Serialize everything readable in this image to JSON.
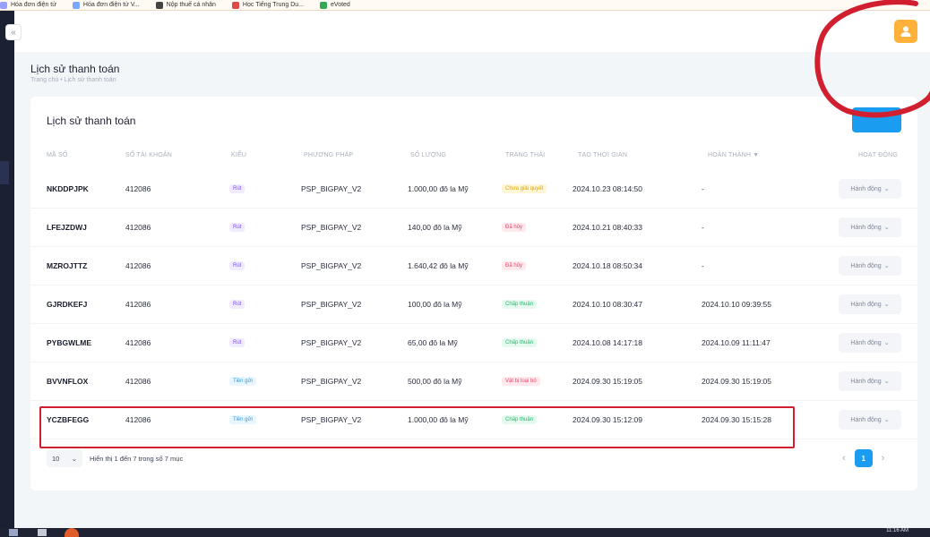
{
  "bookmarks": [
    {
      "label": "Hóa đơn điện tử",
      "color": "#9aa0ff"
    },
    {
      "label": "Hóa đơn điện tử V...",
      "color": "#7aa7ff"
    },
    {
      "label": "Nộp thuế cá nhân",
      "color": "#444444"
    },
    {
      "label": "Học Tiếng Trung Du...",
      "color": "#e04a4a"
    },
    {
      "label": "eVoted",
      "color": "#34a853"
    }
  ],
  "header": {
    "page_title": "Lịch sử thanh toán",
    "breadcrumb": "Trang chủ  •  Lịch sử thanh toán",
    "avatar_icon": "user-icon"
  },
  "card": {
    "title": "Lịch sử thanh toán",
    "columns": [
      "MÃ SỐ",
      "SỐ TÀI KHOẢN",
      "KIỂU",
      "PHƯƠNG PHÁP",
      "SỐ LƯỢNG",
      "TRẠNG THÁI",
      "TẠO THỜI GIAN",
      "HOÀN THÀNH ▼",
      "HOẠT ĐỘNG"
    ],
    "rows": [
      {
        "code": "NKDDPJPK",
        "account": "412086",
        "type": "Rút",
        "type_kind": "rut",
        "method": "PSP_BIGPAY_V2",
        "amount": "1.000,00 đô la Mỹ",
        "status": "Chưa giải quyết",
        "status_kind": "wait",
        "created": "2024.10.23 08:14:50",
        "completed": "-",
        "action": "Hành động"
      },
      {
        "code": "LFEJZDWJ",
        "account": "412086",
        "type": "Rút",
        "type_kind": "rut",
        "method": "PSP_BIGPAY_V2",
        "amount": "140,00 đô la Mỹ",
        "status": "Đã hủy",
        "status_kind": "cancel",
        "created": "2024.10.21 08:40:33",
        "completed": "-",
        "action": "Hành động"
      },
      {
        "code": "MZROJTTZ",
        "account": "412086",
        "type": "Rút",
        "type_kind": "rut",
        "method": "PSP_BIGPAY_V2",
        "amount": "1.640,42 đô la Mỹ",
        "status": "Đã hủy",
        "status_kind": "cancel",
        "created": "2024.10.18 08:50:34",
        "completed": "-",
        "action": "Hành động"
      },
      {
        "code": "GJRDKEFJ",
        "account": "412086",
        "type": "Rút",
        "type_kind": "rut",
        "method": "PSP_BIGPAY_V2",
        "amount": "100,00 đô la Mỹ",
        "status": "Chấp thuận",
        "status_kind": "ok",
        "created": "2024.10.10 08:30:47",
        "completed": "2024.10.10 09:39:55",
        "action": "Hành động"
      },
      {
        "code": "PYBGWLME",
        "account": "412086",
        "type": "Rút",
        "type_kind": "rut",
        "method": "PSP_BIGPAY_V2",
        "amount": "65,00 đô la Mỹ",
        "status": "Chấp thuận",
        "status_kind": "ok",
        "created": "2024.10.08 14:17:18",
        "completed": "2024.10.09 11:11:47",
        "action": "Hành động"
      },
      {
        "code": "BVVNFLOX",
        "account": "412086",
        "type": "Tiền gửi",
        "type_kind": "tien",
        "method": "PSP_BIGPAY_V2",
        "amount": "500,00 đô la Mỹ",
        "status": "Vật bị loại bỏ",
        "status_kind": "rm",
        "created": "2024.09.30 15:19:05",
        "completed": "2024.09.30 15:19:05",
        "action": "Hành động"
      },
      {
        "code": "YCZBFEGG",
        "account": "412086",
        "type": "Tiền gửi",
        "type_kind": "tien",
        "method": "PSP_BIGPAY_V2",
        "amount": "1.000,00 đô la Mỹ",
        "status": "Chấp thuận",
        "status_kind": "ok",
        "created": "2024.09.30 15:12:09",
        "completed": "2024.09.30 15:15:28",
        "action": "Hành động"
      }
    ],
    "page_size": "10",
    "showing": "Hiển thị 1 đến 7 trong số 7 mục",
    "current_page": "1"
  },
  "taskbar": {
    "time": "11:16 AM"
  },
  "colors": {
    "accent": "#1a9cf0",
    "annotation": "#d21f2f",
    "avatar": "#ffb13c"
  }
}
